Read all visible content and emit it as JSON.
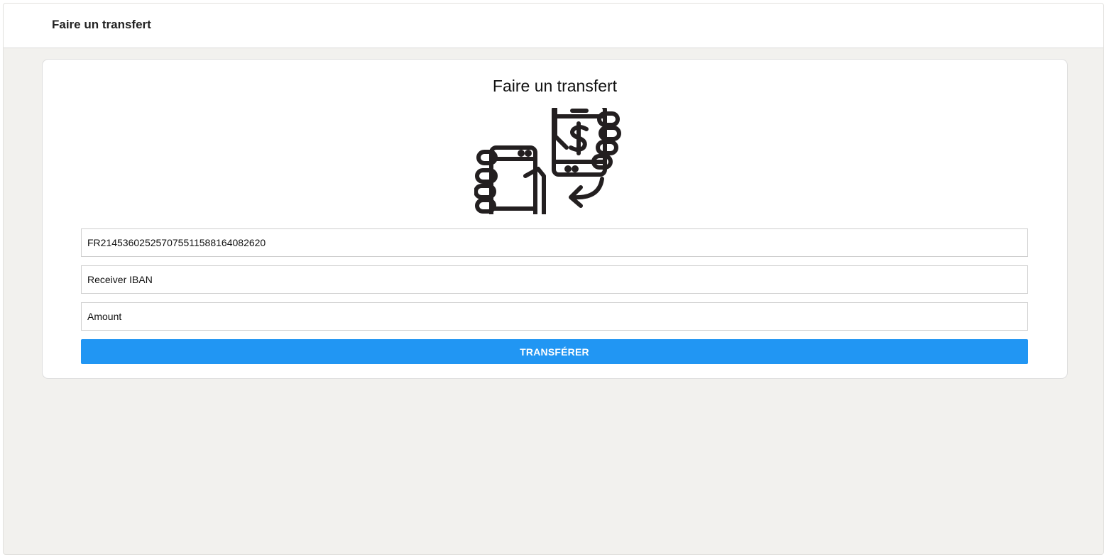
{
  "header": {
    "title": "Faire un transfert"
  },
  "card": {
    "title": "Faire un transfert",
    "illustration": "phone-money-transfer-icon"
  },
  "form": {
    "sender_iban_value": "FR2145360252570755115881640826​20",
    "receiver_iban_placeholder": "Receiver IBAN",
    "amount_placeholder": "Amount",
    "submit_label": "TRANSFÉRER"
  },
  "colors": {
    "background": "#f2f1ee",
    "accent": "#2196f3",
    "text": "#111111"
  }
}
